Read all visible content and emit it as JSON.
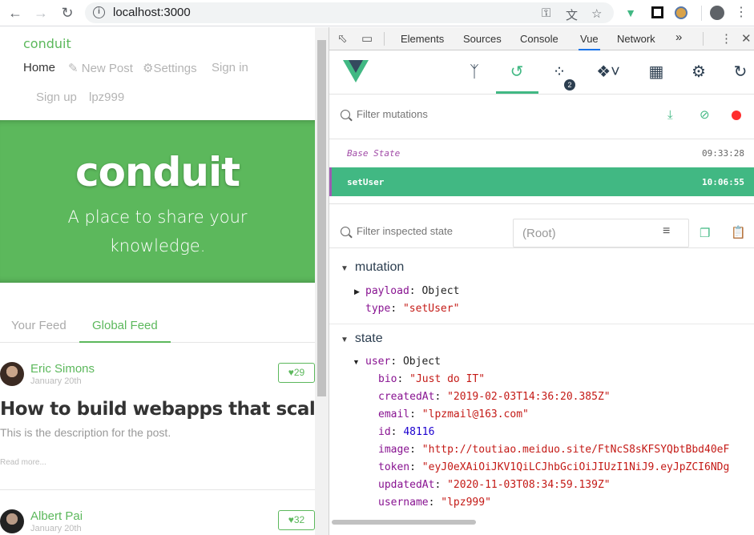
{
  "browser": {
    "url": "localhost:3000"
  },
  "page": {
    "brand": "conduit",
    "nav": [
      "Home",
      "New Post",
      "Settings",
      "Sign in",
      "Sign up",
      "lpz999"
    ],
    "banner": {
      "title": "conduit",
      "tagline": "A place to share your knowledge."
    },
    "feed_tabs": [
      "Your Feed",
      "Global Feed"
    ],
    "articles": [
      {
        "author": "Eric Simons",
        "date": "January 20th",
        "likes": "29",
        "title": "How to build webapps that scale",
        "description": "This is the description for the post.",
        "read_more": "Read more..."
      },
      {
        "author": "Albert Pai",
        "date": "January 20th",
        "likes": "32"
      }
    ]
  },
  "devtools": {
    "tabs": [
      "Elements",
      "Sources",
      "Console",
      "Vue",
      "Network"
    ],
    "active_tab": "Vue",
    "more": "»",
    "vue": {
      "badge": "2",
      "filter_mutations_placeholder": "Filter mutations",
      "mutations": [
        {
          "name": "Base State",
          "time": "09:33:28"
        },
        {
          "name": "setUser",
          "time": "10:06:55"
        }
      ],
      "filter_state_placeholder": "Filter inspected state",
      "root_select": "(Root)",
      "mutation_section": {
        "title": "mutation",
        "payload_key": "payload",
        "payload_val": "Object",
        "type_key": "type",
        "type_val": "\"setUser\""
      },
      "state_section": {
        "title": "state",
        "user_key": "user",
        "user_val": "Object",
        "fields": [
          {
            "key": "bio",
            "value": "\"Just do IT\"",
            "kind": "str"
          },
          {
            "key": "createdAt",
            "value": "\"2019-02-03T14:36:20.385Z\"",
            "kind": "str"
          },
          {
            "key": "email",
            "value": "\"lpzmail@163.com\"",
            "kind": "str"
          },
          {
            "key": "id",
            "value": "48116",
            "kind": "num"
          },
          {
            "key": "image",
            "value": "\"http://toutiao.meiduo.site/FtNcS8sKFSYQbtBbd40eF",
            "kind": "str"
          },
          {
            "key": "token",
            "value": "\"eyJ0eXAiOiJKV1QiLCJhbGciOiJIUzI1NiJ9.eyJpZCI6NDg",
            "kind": "str"
          },
          {
            "key": "updatedAt",
            "value": "\"2020-11-03T08:34:59.139Z\"",
            "kind": "str"
          },
          {
            "key": "username",
            "value": "\"lpz999\"",
            "kind": "str"
          }
        ]
      }
    }
  },
  "colors": {
    "conduit_green": "#5cb85c",
    "vue_green": "#41b883",
    "vue_purple": "#9e5bb3"
  }
}
